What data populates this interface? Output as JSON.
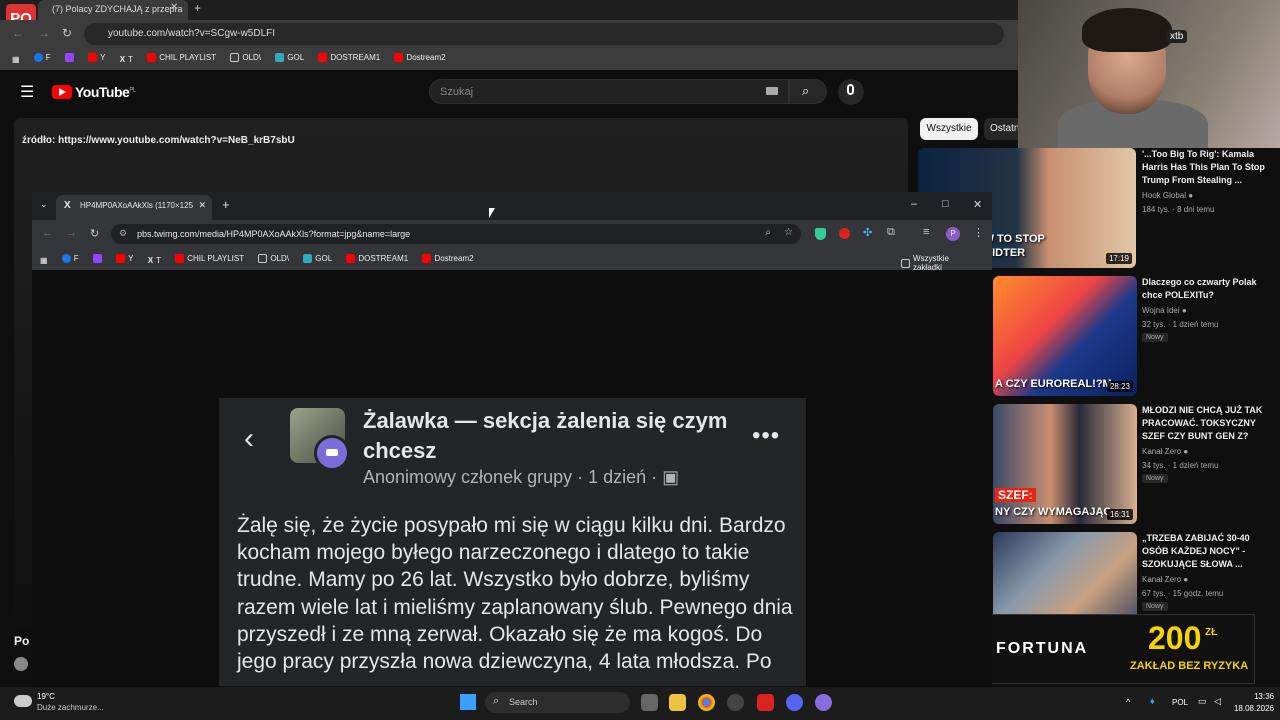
{
  "bg_browser": {
    "tab_title": "(7) Polacy ZDYCHAJĄ z przepra",
    "url": "youtube.com/watch?v=SCgw-w5DLFI",
    "bookmarks": [
      "F",
      "",
      "Y",
      "T",
      "CHIL PLAYLIST",
      "OLD\\",
      "GOL",
      "DOSTREAM1",
      "Dostream2"
    ],
    "logo_text": "PO"
  },
  "youtube": {
    "logo": "YouTube",
    "region": "PL",
    "search_placeholder": "Szukaj",
    "source_text": "źródło: https://www.youtube.com/watch?v=NeB_krB7sbU",
    "chips": [
      "Wszystkie",
      "Ostatn"
    ],
    "channel_partial": "Po",
    "sidebar": [
      {
        "title": "'...Too Big To Rig': Kamala Harris Has This Plan To Stop Trump From Stealing ...",
        "channel": "Hook Global",
        "meta": "184 tys. · 8 dni temu",
        "duration": "17:19",
        "caption": "EVEALS HOW TO STOP\nM RIGGING MIDTER",
        "new": ""
      },
      {
        "title": "Dlaczego co czwarty Polak chce POLEXITu?",
        "channel": "Wojna Idei",
        "meta": "32 tys. · 1 dzień temu",
        "duration": "28:23",
        "caption": "A CZY EUROREAL!?M",
        "new": "Nowy"
      },
      {
        "title": "MŁODZI NIE CHCĄ JUŻ TAK PRACOWAĆ. TOKSYCZNY SZEF CZY BUNT GEN Z?",
        "channel": "Kanał Zero",
        "meta": "34 tys. · 1 dzień temu",
        "duration": "16:31",
        "caption": "NY CZY WYMAGAJĄC",
        "new": "Nowy"
      },
      {
        "title": "„TRZEBA ZABIJAĆ 30-40 OSÓB KAŻDEJ NOCY\" - SZOKUJĄCE SŁOWA ...",
        "channel": "Kanał Zero",
        "meta": "67 tys. · 15 godz. temu",
        "duration": "",
        "caption": "",
        "new": "Nowy"
      }
    ],
    "ad": {
      "brand": "FORTUNA",
      "amount": "200",
      "currency": "ZŁ",
      "sub": "ZAKŁAD BEZ RYZYKA"
    }
  },
  "webcam": {
    "badge": "xtb"
  },
  "fg_browser": {
    "tab_title": "HP4MP0AXoAAkXls (1170×125",
    "url": "pbs.twimg.com/media/HP4MP0AXoAAkXls?format=jpg&name=large",
    "bookmarks": [
      "F",
      "",
      "Y",
      "T",
      "CHIL PLAYLIST",
      "OLD\\",
      "GOL",
      "DOSTREAM1",
      "Dostream2"
    ],
    "all_bookmarks": "Wszystkie zakładki",
    "profile": "P"
  },
  "post": {
    "group_name": "Żalawka — sekcja żalenia się czym chcesz",
    "member": "Anonimowy członek grupy",
    "time": "1 dzień",
    "body": "Żalę się, że życie posypało mi się w ciągu kilku dni. Bardzo kocham mojego byłego narzeczonego i dlatego to takie trudne. Mamy po 26 lat. Wszystko było dobrze, byliśmy razem wiele lat i mieliśmy zaplanowany ślub. Pewnego dnia przyszedł i ze mną zerwał. Okazało się że ma kogoś. Do jego pracy przyszła nowa dziewczyna, 4 lata młodsza. Po"
  },
  "taskbar": {
    "temp": "19°C",
    "weather": "Duże zachmurze...",
    "search": "Search",
    "lang": "POL",
    "time": "13:36",
    "date": "18.08.2026"
  },
  "colors": {
    "yt_red": "#ff0000",
    "accent": "#7b6cd9",
    "ad_yellow": "#f5d400"
  }
}
